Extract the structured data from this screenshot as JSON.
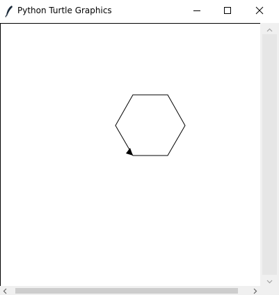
{
  "window": {
    "title": "Python Turtle Graphics"
  },
  "titlebar": {
    "app_icon": "feather-icon",
    "minimize_icon": "minimize-icon",
    "maximize_icon": "maximize-icon",
    "close_icon": "close-icon"
  },
  "canvas": {
    "background": "#ffffff",
    "stroke_color": "#000000",
    "shape": "hexagon",
    "turtle_icon": "turtle-arrow-icon"
  },
  "scrollbars": {
    "vertical": {
      "up_icon": "chevron-up-icon",
      "down_icon": "chevron-down-icon"
    },
    "horizontal": {
      "left_icon": "chevron-left-icon",
      "right_icon": "chevron-right-icon"
    }
  }
}
